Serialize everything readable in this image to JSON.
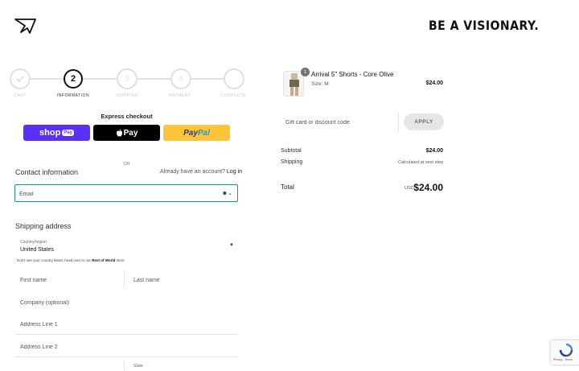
{
  "header": {
    "logo_icon": "gymshark-shark-icon",
    "tagline": "BE A VISIONARY."
  },
  "stepper": {
    "steps": [
      {
        "label": "CART",
        "number": "",
        "state": "done"
      },
      {
        "label": "INFORMATION",
        "number": "2",
        "state": "active"
      },
      {
        "label": "SHIPPING",
        "number": "3",
        "state": "todo"
      },
      {
        "label": "PAYMENT",
        "number": "4",
        "state": "todo"
      },
      {
        "label": "COMPLETE",
        "number": "5",
        "state": "todo"
      }
    ]
  },
  "express": {
    "title": "Express checkout",
    "shoppay": "shop",
    "shoppay_pill": "Pay",
    "applepay": "Pay",
    "paypal_a": "Pay",
    "paypal_b": "Pal",
    "or": "OR"
  },
  "contact": {
    "title": "Contact information",
    "have_account": "Already have an account?",
    "login": "Log in",
    "email_placeholder": "Email"
  },
  "shipping": {
    "title": "Shipping address",
    "country_label": "Country/region",
    "country_value": "United States",
    "rest_note_a": "Don't see your country listed, head over to our",
    "rest_note_link": "Rest of World",
    "rest_note_b": "store",
    "first_name": "First name",
    "last_name": "Last name",
    "company": "Company (optional)",
    "address1": "Address Line 1",
    "address2": "Address Line 2",
    "state": "State"
  },
  "order": {
    "product_name": "Arrival 5\" Shorts - Core Olive",
    "product_size": "Size: M",
    "product_qty": "1",
    "product_price": "$24.00",
    "gift_placeholder": "Gift card or discount code",
    "apply": "APPLY",
    "subtotal_label": "Subtotal",
    "subtotal_value": "$24.00",
    "shipping_label": "Shipping",
    "shipping_value": "Calculated at next step",
    "total_label": "Total",
    "currency": "USD",
    "total_value": "$24.00"
  },
  "recaptcha": {
    "terms": "Privacy - Terms"
  },
  "colors": {
    "focus_border": "#1a91ba",
    "shoppay": "#5a31f4",
    "paypal": "#ffc439"
  }
}
